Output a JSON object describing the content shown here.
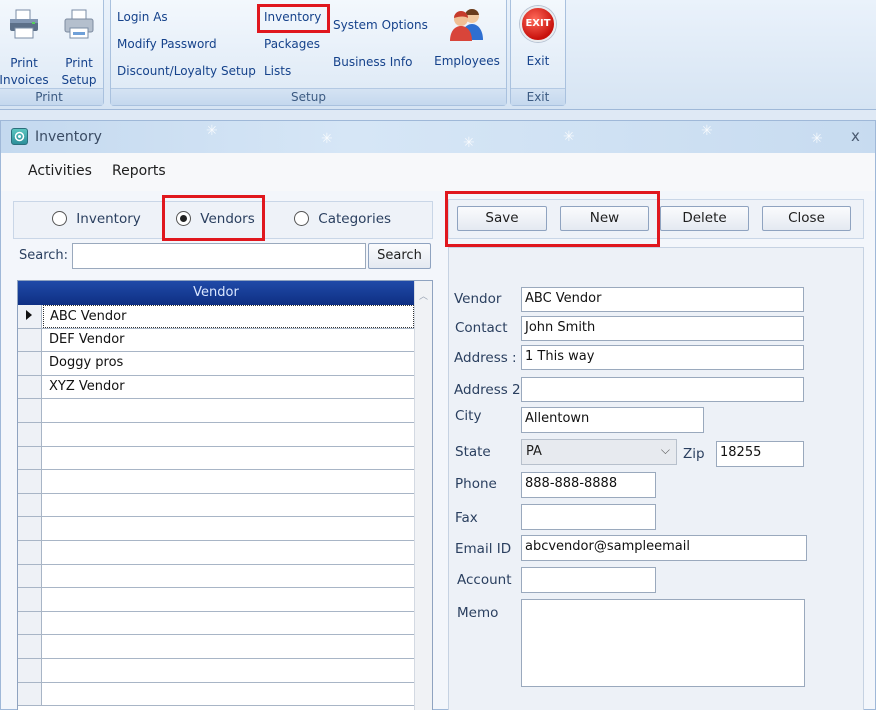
{
  "ribbon": {
    "print_group": {
      "label": "Print",
      "print_invoices": "Print\nInvoices",
      "print_invoices_l1": "Print",
      "print_invoices_l2": "Invoices",
      "print_setup_l1": "Print",
      "print_setup_l2": "Setup"
    },
    "setup_group": {
      "label": "Setup",
      "login_as": "Login As",
      "modify_password": "Modify Password",
      "discount_setup": "Discount/Loyalty Setup",
      "inventory": "Inventory",
      "packages": "Packages",
      "lists": "Lists",
      "system_options": "System Options",
      "business_info": "Business Info",
      "employees": "Employees"
    },
    "exit_group": {
      "label": "Exit",
      "exit": "Exit",
      "exit_icon_text": "EXIT"
    }
  },
  "window": {
    "title": "Inventory",
    "close_glyph": "x"
  },
  "menu": {
    "activities": "Activities",
    "reports": "Reports"
  },
  "view_selector": {
    "options": [
      "Inventory",
      "Vendors",
      "Categories"
    ],
    "selected": "Vendors"
  },
  "search": {
    "label": "Search:",
    "value": "",
    "button": "Search"
  },
  "grid": {
    "column": "Vendor",
    "rows": [
      "ABC Vendor",
      "DEF Vendor",
      "Doggy pros",
      "XYZ Vendor"
    ],
    "selected_row": "ABC Vendor"
  },
  "actions": {
    "save": "Save",
    "new": "New",
    "delete": "Delete",
    "close": "Close"
  },
  "form": {
    "vendor": {
      "label": "Vendor",
      "value": "ABC Vendor"
    },
    "contact": {
      "label": "Contact",
      "value": "John Smith"
    },
    "address": {
      "label": "Address :",
      "value": "1 This way"
    },
    "address2": {
      "label": "Address 2",
      "value": ""
    },
    "city": {
      "label": "City",
      "value": "Allentown"
    },
    "state": {
      "label": "State",
      "value": "PA"
    },
    "zip": {
      "label": "Zip",
      "value": "18255"
    },
    "phone": {
      "label": "Phone",
      "value": "888-888-8888"
    },
    "fax": {
      "label": "Fax",
      "value": ""
    },
    "email": {
      "label": "Email ID",
      "value": "abcvendor@sampleemail"
    },
    "account": {
      "label": "Account",
      "value": ""
    },
    "memo": {
      "label": "Memo",
      "value": ""
    }
  },
  "colors": {
    "highlight": "#e0171e",
    "grid_header": "#1f4aa8",
    "ribbon_text": "#15428b"
  }
}
